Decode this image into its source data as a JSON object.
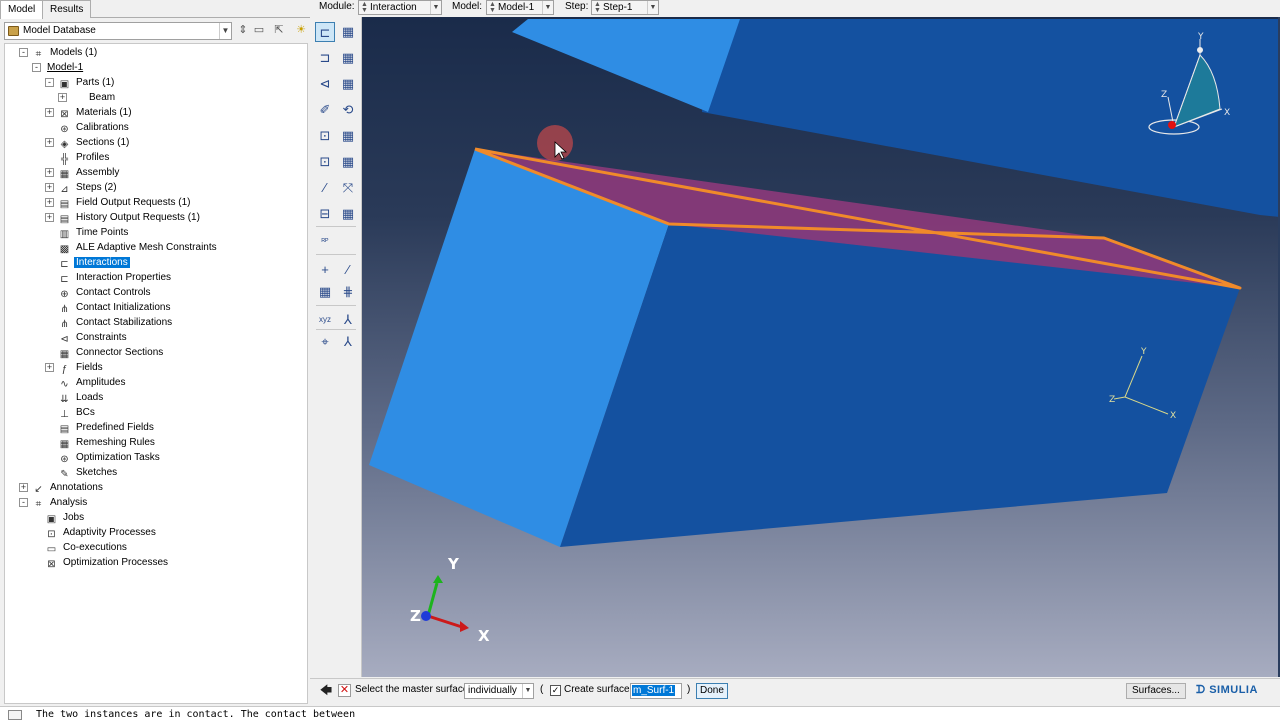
{
  "tabs": [
    "Model",
    "Results"
  ],
  "database": {
    "value": "Model Database"
  },
  "tree": [
    {
      "label": "Models (1)",
      "icon": "models-icon",
      "glyph": "⌗",
      "indent": 0,
      "exp": "-"
    },
    {
      "label": "Model-1",
      "icon": "",
      "glyph": "",
      "indent": 1,
      "exp": "-",
      "underline": true
    },
    {
      "label": "Parts (1)",
      "icon": "parts-icon",
      "glyph": "▣",
      "indent": 2,
      "exp": "-"
    },
    {
      "label": "Beam",
      "icon": "part-icon",
      "glyph": "",
      "indent": 3,
      "exp": "+"
    },
    {
      "label": "Materials (1)",
      "icon": "materials-icon",
      "glyph": "⊠",
      "indent": 2,
      "exp": "+"
    },
    {
      "label": "Calibrations",
      "icon": "calibrations-icon",
      "glyph": "⊛",
      "indent": 2,
      "exp": ""
    },
    {
      "label": "Sections (1)",
      "icon": "sections-icon",
      "glyph": "◈",
      "indent": 2,
      "exp": "+"
    },
    {
      "label": "Profiles",
      "icon": "profiles-icon",
      "glyph": "╬",
      "indent": 2,
      "exp": ""
    },
    {
      "label": "Assembly",
      "icon": "assembly-icon",
      "glyph": "▦",
      "indent": 2,
      "exp": "+"
    },
    {
      "label": "Steps (2)",
      "icon": "steps-icon",
      "glyph": "⊿",
      "indent": 2,
      "exp": "+"
    },
    {
      "label": "Field Output Requests (1)",
      "icon": "field-output-icon",
      "glyph": "▤",
      "indent": 2,
      "exp": "+"
    },
    {
      "label": "History Output Requests (1)",
      "icon": "history-output-icon",
      "glyph": "▤",
      "indent": 2,
      "exp": "+"
    },
    {
      "label": "Time Points",
      "icon": "time-points-icon",
      "glyph": "▥",
      "indent": 2,
      "exp": ""
    },
    {
      "label": "ALE Adaptive Mesh Constraints",
      "icon": "ale-icon",
      "glyph": "▩",
      "indent": 2,
      "exp": ""
    },
    {
      "label": "Interactions",
      "icon": "interactions-icon",
      "glyph": "⊏",
      "indent": 2,
      "exp": "",
      "selected": true
    },
    {
      "label": "Interaction Properties",
      "icon": "interaction-properties-icon",
      "glyph": "⊏",
      "indent": 2,
      "exp": ""
    },
    {
      "label": "Contact Controls",
      "icon": "contact-controls-icon",
      "glyph": "⊕",
      "indent": 2,
      "exp": ""
    },
    {
      "label": "Contact Initializations",
      "icon": "contact-init-icon",
      "glyph": "⋔",
      "indent": 2,
      "exp": ""
    },
    {
      "label": "Contact Stabilizations",
      "icon": "contact-stab-icon",
      "glyph": "⋔",
      "indent": 2,
      "exp": ""
    },
    {
      "label": "Constraints",
      "icon": "constraints-icon",
      "glyph": "⊲",
      "indent": 2,
      "exp": ""
    },
    {
      "label": "Connector Sections",
      "icon": "connector-sections-icon",
      "glyph": "▦",
      "indent": 2,
      "exp": ""
    },
    {
      "label": "Fields",
      "icon": "fields-icon",
      "glyph": "ƒ",
      "indent": 2,
      "exp": "+"
    },
    {
      "label": "Amplitudes",
      "icon": "amplitudes-icon",
      "glyph": "∿",
      "indent": 2,
      "exp": ""
    },
    {
      "label": "Loads",
      "icon": "loads-icon",
      "glyph": "⇊",
      "indent": 2,
      "exp": ""
    },
    {
      "label": "BCs",
      "icon": "bcs-icon",
      "glyph": "⊥",
      "indent": 2,
      "exp": ""
    },
    {
      "label": "Predefined Fields",
      "icon": "predefined-fields-icon",
      "glyph": "▤",
      "indent": 2,
      "exp": ""
    },
    {
      "label": "Remeshing Rules",
      "icon": "remeshing-icon",
      "glyph": "▦",
      "indent": 2,
      "exp": ""
    },
    {
      "label": "Optimization Tasks",
      "icon": "optimization-tasks-icon",
      "glyph": "⊛",
      "indent": 2,
      "exp": ""
    },
    {
      "label": "Sketches",
      "icon": "sketches-icon",
      "glyph": "✎",
      "indent": 2,
      "exp": ""
    },
    {
      "label": "Annotations",
      "icon": "annotations-icon",
      "glyph": "↙",
      "indent": 0,
      "exp": "+"
    },
    {
      "label": "Analysis",
      "icon": "analysis-icon",
      "glyph": "⌗",
      "indent": 0,
      "exp": "-"
    },
    {
      "label": "Jobs",
      "icon": "jobs-icon",
      "glyph": "▣",
      "indent": 1,
      "exp": ""
    },
    {
      "label": "Adaptivity Processes",
      "icon": "adaptivity-icon",
      "glyph": "⊡",
      "indent": 1,
      "exp": ""
    },
    {
      "label": "Co-executions",
      "icon": "coexec-icon",
      "glyph": "▭",
      "indent": 1,
      "exp": ""
    },
    {
      "label": "Optimization Processes",
      "icon": "optimization-processes-icon",
      "glyph": "⊠",
      "indent": 1,
      "exp": ""
    }
  ],
  "toolbar": {
    "module_label": "Module:",
    "module_value": "Interaction",
    "model_label": "Model:",
    "model_value": "Model-1",
    "step_label": "Step:",
    "step_value": "Step-1"
  },
  "toolbox": [
    {
      "icon": "create-interaction-icon",
      "glyph": "⊏",
      "selected": true
    },
    {
      "icon": "interaction-manager-icon",
      "glyph": "▦"
    },
    {
      "icon": "create-interaction-property-icon",
      "glyph": "⊐"
    },
    {
      "icon": "interaction-property-manager-icon",
      "glyph": "▦"
    },
    {
      "icon": "create-constraint-icon",
      "glyph": "⊲"
    },
    {
      "icon": "constraint-manager-icon",
      "glyph": "▦"
    },
    {
      "icon": "create-connector-icon",
      "glyph": "✐"
    },
    {
      "icon": "create-connector-section-icon",
      "glyph": "⟲"
    },
    {
      "icon": "create-field-icon",
      "glyph": "⊡"
    },
    {
      "icon": "field-manager-icon",
      "glyph": "▦"
    },
    {
      "icon": "create-amplitude-icon",
      "glyph": "⊡"
    },
    {
      "icon": "amplitude-manager-icon",
      "glyph": "▦"
    },
    {
      "icon": "create-wire-icon",
      "glyph": "⁄"
    },
    {
      "icon": "create-connector-assignment-icon",
      "glyph": "⤧"
    },
    {
      "icon": "create-load-icon",
      "glyph": "⊟"
    },
    {
      "icon": "load-manager-icon",
      "glyph": "▦"
    },
    {
      "icon": "reference-point-icon",
      "glyph": "ᴿᴾ"
    },
    {
      "icon": "create-datum-point-icon",
      "glyph": "+"
    },
    {
      "icon": "create-datum-axis-icon",
      "glyph": "⁄"
    },
    {
      "icon": "partition-icon",
      "glyph": "▦"
    },
    {
      "icon": "datum-plane-icon",
      "glyph": "⋕"
    },
    {
      "icon": "create-datum-csys-icon",
      "glyph": "xyz"
    },
    {
      "icon": "datum-csys-manager-icon",
      "glyph": "⅄"
    },
    {
      "icon": "query-icon",
      "glyph": "⌖"
    },
    {
      "icon": "view-csys-icon",
      "glyph": "⅄"
    }
  ],
  "viewport": {
    "triad_labels": {
      "x": "X",
      "y": "Y",
      "z": "Z"
    },
    "csys_labels": {
      "x": "X",
      "y": "Y",
      "z": "Z"
    },
    "compass_labels": {
      "x": "X",
      "y": "Y",
      "z": "Z"
    },
    "colors": {
      "part_light": "#2f8de4",
      "part_dark": "#1451a0",
      "highlight": "#c8612e",
      "surface_fill": "#8a3a7a",
      "bg_top": "#1a2b4a",
      "bg_bottom": "#a7acc0"
    }
  },
  "prompt": {
    "instruction": "Select the master surface",
    "method": "individually",
    "paren_open": "(",
    "paren_close": ")",
    "create_surface_label": "Create surface:",
    "create_surface_checked": true,
    "surface_name": "m_Surf-1",
    "done_label": "Done",
    "surfaces_label": "Surfaces...",
    "brand": "SIMULIA"
  },
  "message": "The two instances are in contact. The contact between"
}
